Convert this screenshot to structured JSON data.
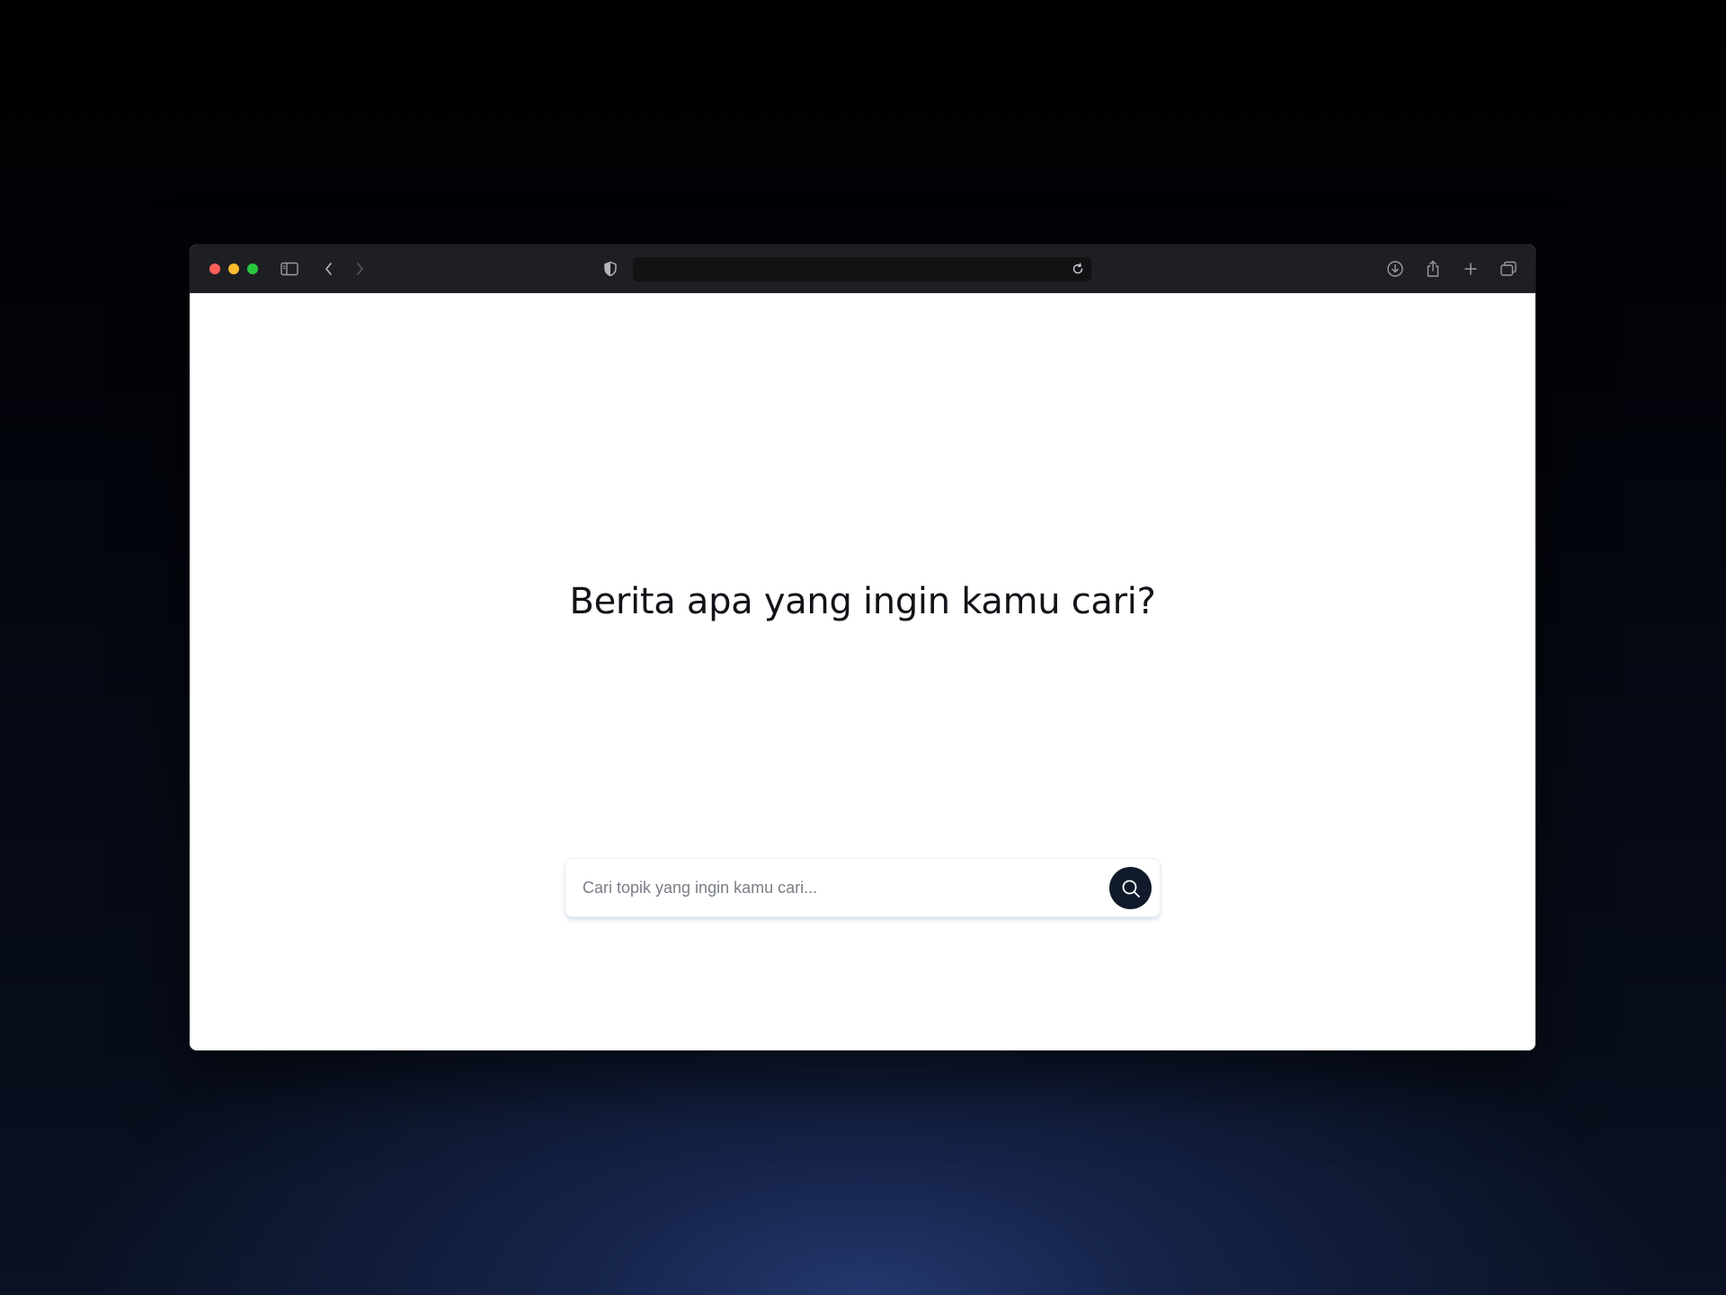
{
  "browser": {
    "url": "",
    "icons": {
      "sidebar": "sidebar-icon",
      "back": "chevron-left-icon",
      "forward": "chevron-right-icon",
      "privacy": "shield-icon",
      "reload": "reload-icon",
      "download": "download-icon",
      "share": "share-icon",
      "new_tab": "plus-icon",
      "tabs_overview": "tabs-icon"
    }
  },
  "page": {
    "heading": "Berita apa yang ingin kamu cari?",
    "search": {
      "placeholder": "Cari topik yang ingin kamu cari...",
      "value": "",
      "button_icon": "search-icon"
    }
  },
  "colors": {
    "search_button": "#111a2b",
    "heading": "#111318",
    "titlebar": "#1e1f22"
  }
}
